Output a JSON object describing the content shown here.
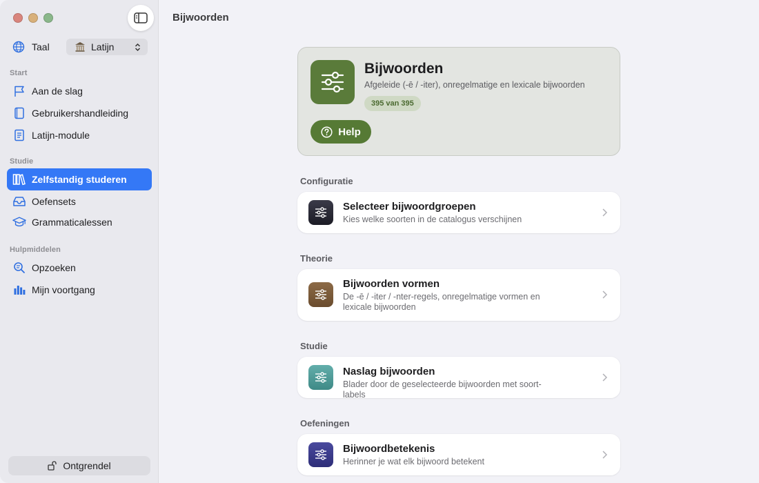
{
  "window": {
    "title": "Bijwoorden"
  },
  "sidebar": {
    "language": {
      "label": "Taal",
      "selected": "Latijn"
    },
    "sections": {
      "start": "Start",
      "study": "Studie",
      "tools": "Hulpmiddelen"
    },
    "items": [
      {
        "label": "Aan de slag",
        "icon": "flag-icon"
      },
      {
        "label": "Gebruikershandleiding",
        "icon": "book-icon"
      },
      {
        "label": "Latijn-module",
        "icon": "notebook-icon"
      },
      {
        "label": "Zelfstandig studeren",
        "icon": "library-icon",
        "active": true
      },
      {
        "label": "Oefensets",
        "icon": "tray-icon"
      },
      {
        "label": "Grammaticalessen",
        "icon": "graduation-cap-icon"
      },
      {
        "label": "Opzoeken",
        "icon": "magnifier-icon"
      },
      {
        "label": "Mijn voortgang",
        "icon": "bar-chart-icon"
      }
    ],
    "unlock_label": "Ontgrendel"
  },
  "hero": {
    "title": "Bijwoorden",
    "subtitle": "Afgeleide (-ē / -iter), onregelmatige en lexicale bijwoorden",
    "badge": "395 van 395",
    "help_label": "Help",
    "color": "#5a7b3a"
  },
  "groups": [
    {
      "label": "Configuratie",
      "card": {
        "title": "Selecteer bijwoordgroepen",
        "subtitle": "Kies welke soorten in de catalogus verschijnen",
        "color": "#2a2a35"
      }
    },
    {
      "label": "Theorie",
      "card": {
        "title": "Bijwoorden vormen",
        "subtitle": "De -ē / -iter / -nter-regels, onregelmatige vormen en lexicale bijwoorden",
        "color": "#7a5a3a"
      }
    },
    {
      "label": "Studie",
      "card": {
        "title": "Naslag bijwoorden",
        "subtitle": "Blader door de geselecteerde bijwoorden met soort-labels",
        "color": "#4f9b98"
      }
    },
    {
      "label": "Oefeningen",
      "card": {
        "title": "Bijwoordbetekenis",
        "subtitle": "Herinner je wat elk bijwoord betekent",
        "color": "#3a3a8a"
      }
    }
  ]
}
